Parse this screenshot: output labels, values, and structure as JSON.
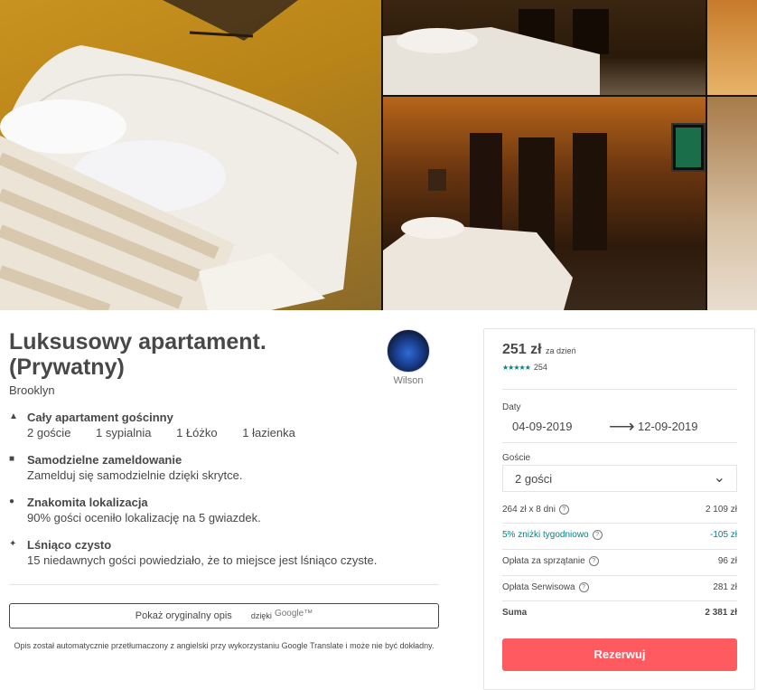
{
  "listing": {
    "title": "Luksusowy apartament. (Prywatny)",
    "location": "Brooklyn"
  },
  "host": {
    "name": "Wilson"
  },
  "features": [
    {
      "icon": "house-icon",
      "heading": "Cały apartament gościnny",
      "details": [
        "2 goście",
        "1 sypialnia",
        "1 Łóżko",
        "1 łazienka"
      ]
    },
    {
      "icon": "door-icon",
      "heading": "Samodzielne zameldowanie",
      "details": [
        "Zamelduj się samodzielnie dzięki skrytce."
      ]
    },
    {
      "icon": "pin-icon",
      "heading": "Znakomita lokalizacja",
      "details": [
        "90% gości oceniło lokalizację na 5 gwiazdek."
      ]
    },
    {
      "icon": "sparkle-icon",
      "heading": "Lśniąco czysto",
      "details": [
        "15 niedawnych gości powiedziało, że to miejsce jest lśniąco czyste."
      ]
    }
  ],
  "translation": {
    "button_label": "Pokaż oryginalny opis",
    "thanks": "dzięki",
    "google": "Google™",
    "disclaimer": "Opis został automatycznie przetłumaczony z angielski przy wykorzystaniu Google Translate i może nie być dokładny."
  },
  "booking": {
    "price": "251 zł",
    "per": "za dzień",
    "stars": "★★★★★",
    "reviews": "254",
    "dates_label": "Daty",
    "checkin": "04-09-2019",
    "checkout": "12-09-2019",
    "guests_label": "Goście",
    "guests_value": "2 gości",
    "lines": [
      {
        "label": "264 zł x 8 dni",
        "value": "2 109 zł",
        "help": true
      },
      {
        "label": "5% zniżki tygodniowo",
        "value": "-105 zł",
        "help": true
      },
      {
        "label": "Opłata za sprzątanie",
        "value": "96 zł",
        "help": true
      },
      {
        "label": "Opłata Serwisowa",
        "value": "281 zł",
        "help": true
      },
      {
        "label": "Suma",
        "value": "2 381 zł",
        "help": false
      }
    ],
    "reserve_label": "Rezerwuj",
    "accent_color": "#ff5a5f",
    "discount_color": "#008489"
  }
}
